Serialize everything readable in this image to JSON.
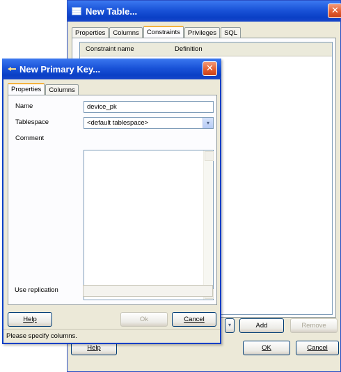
{
  "back_window": {
    "title": "New Table...",
    "tabs": [
      "Properties",
      "Columns",
      "Constraints",
      "Privileges",
      "SQL"
    ],
    "active_tab": "Constraints",
    "grid_columns": [
      "Constraint name",
      "Definition"
    ],
    "buttons": {
      "dropdown_glyph": "▾",
      "add": "Add",
      "remove": "Remove",
      "help": "Help",
      "ok": "OK",
      "cancel": "Cancel"
    },
    "close_glyph": "✕"
  },
  "dialog": {
    "title": "New Primary Key...",
    "tabs": [
      "Properties",
      "Columns"
    ],
    "active_tab": "Properties",
    "fields": {
      "name_label": "Name",
      "name_value": "device_pk",
      "tablespace_label": "Tablespace",
      "tablespace_value": "<default tablespace>",
      "comment_label": "Comment",
      "comment_value": "",
      "replication_label": "Use replication"
    },
    "buttons": {
      "help": "Help",
      "ok": "Ok",
      "cancel": "Cancel"
    },
    "status": "Please specify columns.",
    "close_glyph": "✕"
  },
  "colors": {
    "titlebar": "#0a3fc6",
    "dialog_bg": "#ece9d8",
    "close_button": "#e25a2d"
  }
}
